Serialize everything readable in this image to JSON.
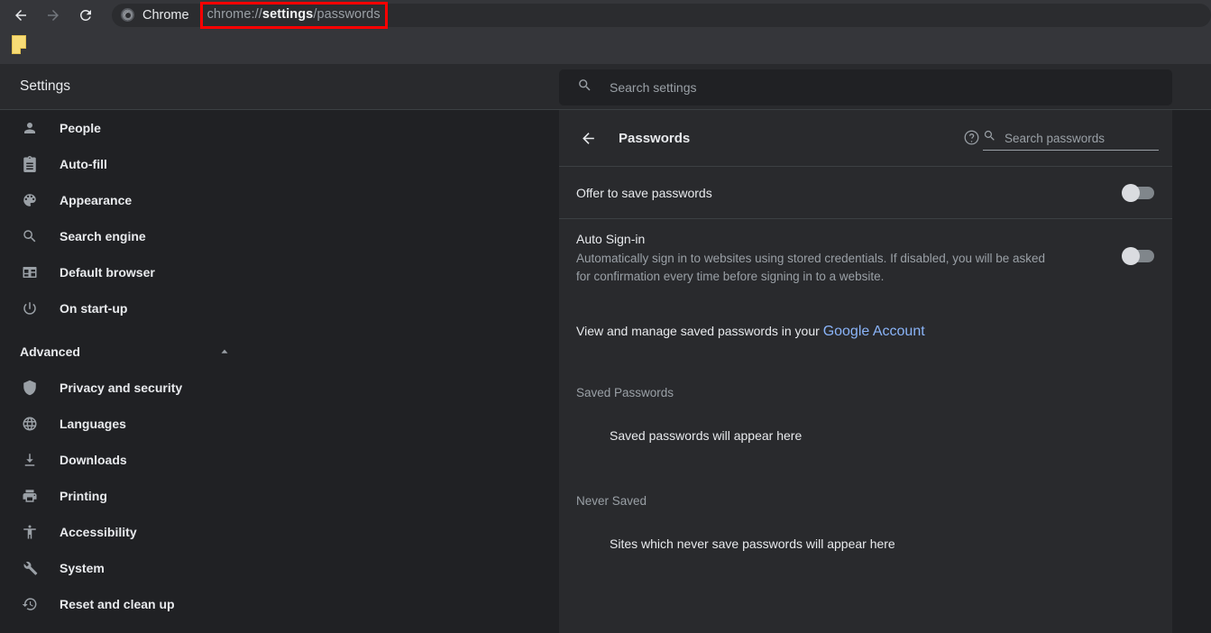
{
  "browser": {
    "nav": {
      "back_label": "Back",
      "forward_label": "Forward",
      "reload_label": "Reload"
    },
    "app_label": "Chrome",
    "url": {
      "prefix": "chrome://",
      "highlight": "settings",
      "suffix": "/passwords",
      "full": "chrome://settings/passwords"
    },
    "bookmark_label": ""
  },
  "header": {
    "title": "Settings",
    "search_placeholder": "Search settings",
    "search_value": ""
  },
  "sidebar": {
    "items": [
      {
        "label": "People",
        "icon": "person-icon"
      },
      {
        "label": "Auto-fill",
        "icon": "clipboard-icon"
      },
      {
        "label": "Appearance",
        "icon": "palette-icon"
      },
      {
        "label": "Search engine",
        "icon": "search-icon"
      },
      {
        "label": "Default browser",
        "icon": "browser-window-icon"
      },
      {
        "label": "On start-up",
        "icon": "power-icon"
      }
    ],
    "advanced": {
      "label": "Advanced",
      "expanded": true,
      "chevron": "chevron-up-icon"
    },
    "advanced_items": [
      {
        "label": "Privacy and security",
        "icon": "shield-icon"
      },
      {
        "label": "Languages",
        "icon": "globe-icon"
      },
      {
        "label": "Downloads",
        "icon": "download-icon"
      },
      {
        "label": "Printing",
        "icon": "printer-icon"
      },
      {
        "label": "Accessibility",
        "icon": "accessibility-icon"
      },
      {
        "label": "System",
        "icon": "wrench-icon"
      },
      {
        "label": "Reset and clean up",
        "icon": "history-icon"
      }
    ]
  },
  "passwords": {
    "title": "Passwords",
    "back_label": "Back",
    "help_label": "Help",
    "search_placeholder": "Search passwords",
    "search_value": "",
    "offer_to_save": {
      "label": "Offer to save passwords",
      "toggle_state": "off"
    },
    "auto_signin": {
      "label": "Auto Sign-in",
      "description": "Automatically sign in to websites using stored credentials. If disabled, you will be asked for confirmation every time before signing in to a website.",
      "toggle_state": "off"
    },
    "manage": {
      "text": "View and manage saved passwords in your ",
      "link_label": "Google Account"
    },
    "saved_section": {
      "heading": "Saved Passwords",
      "empty_text": "Saved passwords will appear here"
    },
    "never_section": {
      "heading": "Never Saved",
      "empty_text": "Sites which never save passwords will appear here"
    }
  },
  "colors": {
    "link": "#8ab4f8",
    "highlight_box": "#ff0000",
    "sidebar_bg": "#202124",
    "card_bg": "#292a2d",
    "toolbar_bg": "#35363a",
    "text": "#e8eaed",
    "muted_text": "#9aa0a6",
    "bookmark": "#f7dc76"
  }
}
